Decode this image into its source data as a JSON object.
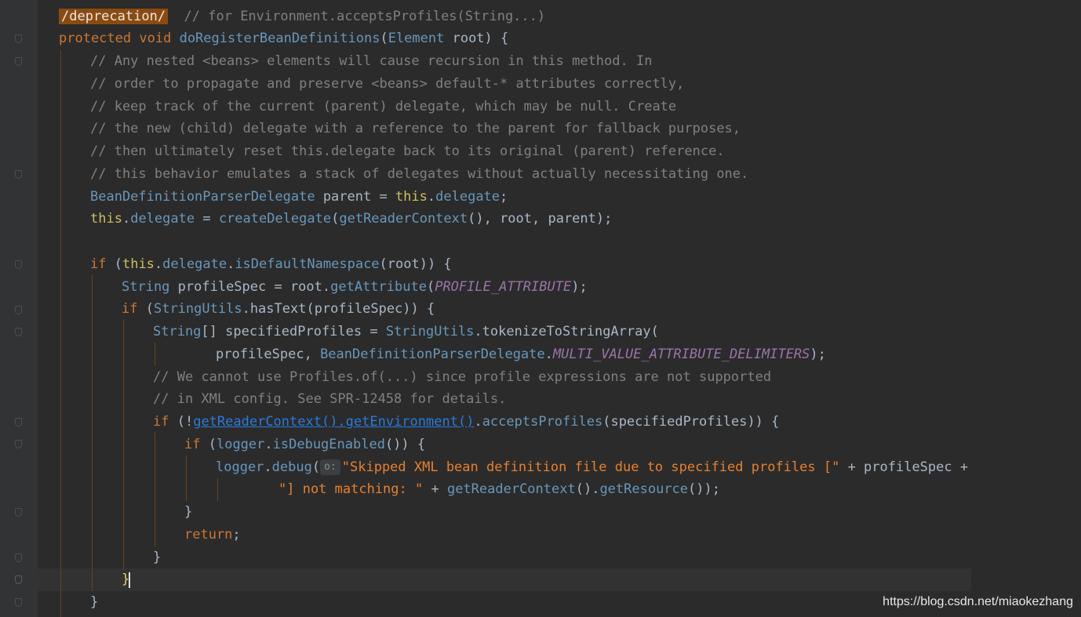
{
  "editor": {
    "colors": {
      "background": "#2b2b2b",
      "gutter": "#313335",
      "keyword": "#cc7832",
      "comment": "#808080",
      "string": "#e8802e",
      "constant": "#9876aa",
      "identifier": "#a9b7c6"
    },
    "lines": {
      "l1": {
        "tag": "/deprecation/",
        "comment": "// for Environment.acceptsProfiles(String...)"
      },
      "l2": {
        "modifier": "protected",
        "ret": "void",
        "name": "doRegisterBeanDefinitions",
        "open": "(",
        "ptype": "Element",
        "pname": " root",
        "close": ") {"
      },
      "l3": {
        "comment": "// Any nested <beans> elements will cause recursion in this method. In"
      },
      "l4": {
        "comment": "// order to propagate and preserve <beans> default-* attributes correctly,"
      },
      "l5": {
        "comment": "// keep track of the current (parent) delegate, which may be null. Create"
      },
      "l6": {
        "comment": "// the new (child) delegate with a reference to the parent for fallback purposes,"
      },
      "l7": {
        "comment": "// then ultimately reset this.delegate back to its original (parent) reference."
      },
      "l8": {
        "comment": "// this behavior emulates a stack of delegates without actually necessitating one."
      },
      "l9": {
        "type": "BeanDefinitionParserDelegate",
        "var": " parent = ",
        "this": "this",
        "field": "delegate",
        "end": ";"
      },
      "l10": {
        "this": "this",
        "field": "delegate",
        "op": " = ",
        "call": "createDelegate",
        "p1": "(",
        "call2": "getReaderContext",
        "rest": "(), root, parent);"
      },
      "l11": {
        "kw": "if",
        "p1": " (",
        "this": "this",
        "field": "delegate",
        "call": "isDefaultNamespace",
        "rest": "(root)) {"
      },
      "l12": {
        "type": "String",
        "var": " profileSpec = root.",
        "call": "getAttribute",
        "p1": "(",
        "const": "PROFILE_ATTRIBUTE",
        "end": ");"
      },
      "l13": {
        "kw": "if",
        "p1": " (",
        "cls": "StringUtils",
        "call": "hasText",
        "rest": "(profileSpec)) {"
      },
      "l14": {
        "type": "String",
        "var": "[] specifiedProfiles = ",
        "cls": "StringUtils",
        "call": "tokenizeToStringArray",
        "end": "("
      },
      "l15": {
        "arg": "profileSpec, ",
        "cls": "BeanDefinitionParserDelegate",
        "const": "MULTI_VALUE_ATTRIBUTE_DELIMITERS",
        "end": ");"
      },
      "l16": {
        "comment": "// We cannot use Profiles.of(...) since profile expressions are not supported"
      },
      "l17": {
        "comment": "// in XML config. See SPR-12458 for details."
      },
      "l18": {
        "kw": "if",
        "p1": " (!",
        "link": "getReaderContext().getEnvironment()",
        "dot": ".",
        "call": "acceptsProfiles",
        "rest": "(specifiedProfiles)) {"
      },
      "l19": {
        "kw": "if",
        "p1": " (",
        "field": "logger",
        "call": "isDebugEnabled",
        "rest": "()) {"
      },
      "l20": {
        "field": "logger",
        "call": "debug",
        "p1": "(",
        "hint": "o:",
        "str": "\"Skipped XML bean definition file due to specified profiles [\"",
        "rest": " + profileSpec +"
      },
      "l21": {
        "str": "\"] not matching: \"",
        "op": " + ",
        "call": "getReaderContext",
        "mid": "().",
        "call2": "getResource",
        "end": "());"
      },
      "l22": {
        "text": "}"
      },
      "l23": {
        "kw": "return",
        "end": ";"
      },
      "l24": {
        "text": "}"
      },
      "l25": {
        "text": "}"
      },
      "l26": {
        "text": "}"
      }
    }
  },
  "watermark": "https://blog.csdn.net/miaokezhang"
}
